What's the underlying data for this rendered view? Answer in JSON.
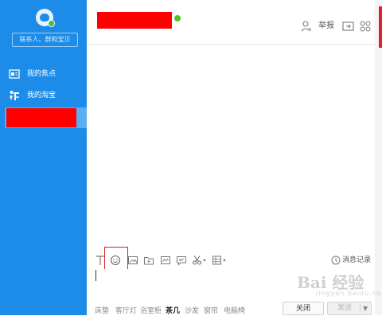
{
  "sidebar": {
    "search_placeholder": "联系人、群和宝贝",
    "items": [
      {
        "label": "我的焦点",
        "icon": "focus-icon"
      },
      {
        "label": "我的淘宝",
        "icon": "taobao-icon"
      }
    ]
  },
  "header": {
    "report_label": "举报"
  },
  "toolbar": {
    "history_label": "消息记录"
  },
  "bottom": {
    "tags": [
      {
        "label": "床垫",
        "bold": false
      },
      {
        "label": "客厅灯",
        "bold": false
      },
      {
        "label": "浴室柜",
        "bold": false
      },
      {
        "label": "茶几",
        "bold": true
      },
      {
        "label": "沙发",
        "bold": false
      },
      {
        "label": "窗帘",
        "bold": false
      },
      {
        "label": "电脑椅",
        "bold": false
      }
    ],
    "close_label": "关闭",
    "send_label": "发送",
    "send_arrow": "▼"
  },
  "watermark": {
    "brand": "Bai 经验",
    "url": "jingyan.baidu.com"
  },
  "colors": {
    "sidebar_bg": "#1c8ce8",
    "redaction": "#ff0000",
    "highlight": "#e02020",
    "online": "#52c41a"
  }
}
